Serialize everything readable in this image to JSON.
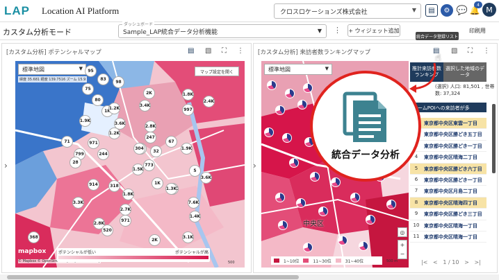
{
  "header": {
    "logo": "LAP",
    "app_name": "Location AI Platform",
    "company": "クロスロケーションズ株式会社",
    "notification_count": "4",
    "user_initial": "M"
  },
  "modebar": {
    "title": "カスタム分析モード",
    "dashboard_label": "ダッシュボード",
    "dashboard_value": "Sample_LAP統合データ分析機能",
    "add_widget": "+ ウィジェット追加",
    "print": "印刷用",
    "tooltip": "統合データ登録リスト"
  },
  "left_panel": {
    "title": "[カスタム分析] ポテンシャルマップ",
    "map_style": "標準地図",
    "map_settings": "マップ設定を開く",
    "latlng": "緯度 35.681 経度 139.7516 ズーム 15.9",
    "legend_low": "ポテンシャルが低い",
    "legend_high": "ポテンシャルが高",
    "attribution": "© Mapbox © OpenStreetMap Improve this map",
    "mapbox": "mapbox",
    "scale": "500",
    "clusters": [
      "95",
      "83",
      "98",
      "75",
      "80",
      "1K",
      "2K",
      "1.2K",
      "3.4K",
      "1.8K",
      "2.4K",
      "1.9K",
      "3.6K",
      "2.8K",
      "997",
      "1.2K",
      "247",
      "71",
      "971",
      "67",
      "799",
      "28",
      "244",
      "36",
      "32",
      "1.9K",
      "773",
      "5",
      "914",
      "318",
      "3.3K",
      "1.8K",
      "2.1K",
      "3.6K",
      "2.7K",
      "7.6K",
      "304",
      "1.5K",
      "1.4K",
      "2.8K",
      "368",
      "971",
      "520",
      "2K",
      "3.1K",
      "1.3K",
      "1K"
    ]
  },
  "right_panel": {
    "title": "[カスタム分析] 来訪者数ランキングマップ",
    "map_style": "標準地図",
    "district": "中央区",
    "tab_a": "推計来訪者数ランキング",
    "tab_b": "選択した地域のデータ",
    "info_line1": "(選択) 人口: 81,501 , 世帯",
    "info_line2": "数: 37,324",
    "rank_header": "ホームPOIへの来訪者が多",
    "rank_items": [
      "東京都中央区東雲一丁目",
      "東京都中央区勝どき五丁目",
      "東京都中央区勝どき一丁目",
      "東京都中央区晴海二丁目",
      "東京都中央区勝どき六丁目",
      "東京都中央区勝どき一丁目",
      "東京都中央区月島二丁目",
      "東京都中央区晴海四丁目",
      "東京都中央区勝どき三丁目",
      "東京都中央区晴海一丁目",
      "東京都中央区晴海一丁目"
    ],
    "legend": [
      "1~10位",
      "11~30位",
      "31~40位"
    ],
    "pager": "1 / 10",
    "scale": "500 m"
  },
  "callout": {
    "label": "統合データ分析"
  }
}
